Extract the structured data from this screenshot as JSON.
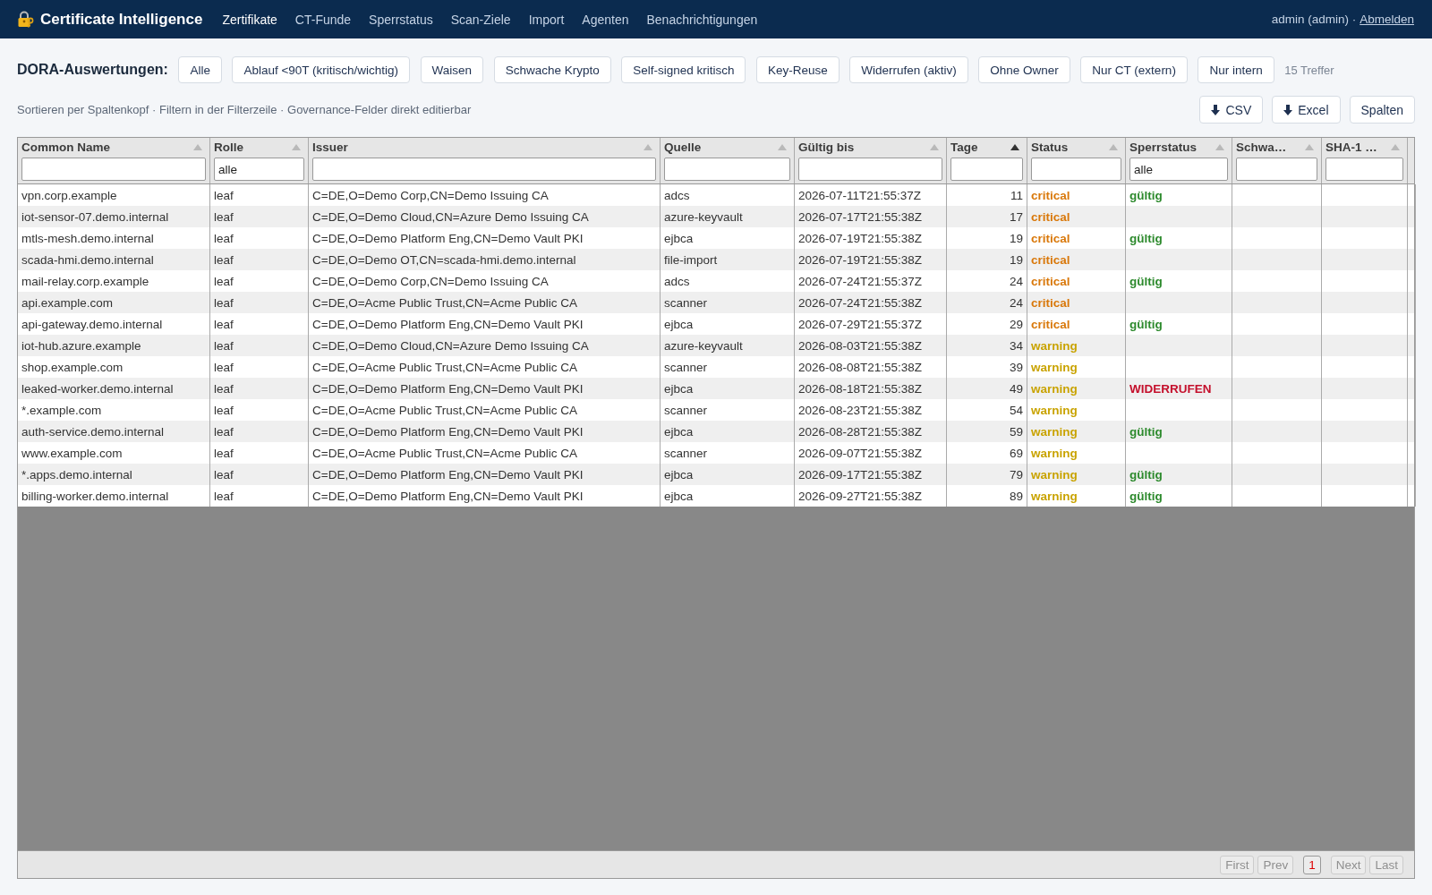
{
  "navbar": {
    "brand": "Certificate Intelligence",
    "nav_items": [
      {
        "label": "Zertifikate",
        "selected": true
      },
      {
        "label": "CT-Funde",
        "selected": false
      },
      {
        "label": "Sperrstatus",
        "selected": false
      },
      {
        "label": "Scan-Ziele",
        "selected": false
      },
      {
        "label": "Import",
        "selected": false
      },
      {
        "label": "Agenten",
        "selected": false
      },
      {
        "label": "Benachrichtigungen",
        "selected": false
      }
    ],
    "user": "admin (admin) ·",
    "logout": "Abmelden"
  },
  "dora_filters": {
    "label": "DORA-Auswertungen:",
    "buttons": [
      "Alle",
      "Ablauf <90T (kritisch/wichtig)",
      "Waisen",
      "Schwache Krypto",
      "Self-signed kritisch",
      "Key-Reuse",
      "Widerrufen (aktiv)",
      "Ohne Owner",
      "Nur CT (extern)",
      "Nur intern"
    ],
    "result_count": "15 Treffer"
  },
  "hint": "Sortieren per Spaltenkopf · Filtern in der Filterzeile · Governance-Felder direkt editierbar",
  "actions": [
    {
      "label": "CSV",
      "kind": "download"
    },
    {
      "label": "Excel",
      "kind": "download"
    },
    {
      "label": "Spalten",
      "kind": "plain"
    }
  ],
  "table": {
    "columns": [
      {
        "title": "Common Name",
        "kind": "text",
        "sorted": false
      },
      {
        "title": "Rolle",
        "kind": "text",
        "sorted": false,
        "filter": "alle"
      },
      {
        "title": "Issuer",
        "kind": "text",
        "sorted": false
      },
      {
        "title": "Quelle",
        "kind": "text",
        "sorted": false
      },
      {
        "title": "Gültig bis",
        "kind": "text",
        "sorted": false
      },
      {
        "title": "Tage",
        "kind": "number",
        "sorted": true
      },
      {
        "title": "Status",
        "kind": "text",
        "sorted": false
      },
      {
        "title": "Sperrstatus",
        "kind": "text",
        "sorted": false,
        "filter": "alle"
      },
      {
        "title": "Schwa…",
        "kind": "text",
        "sorted": false
      },
      {
        "title": "SHA-1 …",
        "kind": "text",
        "sorted": false
      }
    ],
    "rows": [
      {
        "common_name": "vpn.corp.example",
        "role": "leaf",
        "issuer": "C=DE,O=Demo Corp,CN=Demo Issuing CA",
        "source": "adcs",
        "valid_until": "2026-07-11T21:55:37Z",
        "days": "11",
        "status": {
          "text": "critical",
          "color": "#d9780a"
        },
        "revocation": {
          "text": "gültig",
          "color": "#2d8a2d"
        }
      },
      {
        "common_name": "iot-sensor-07.demo.internal",
        "role": "leaf",
        "issuer": "C=DE,O=Demo Cloud,CN=Azure Demo Issuing CA",
        "source": "azure-keyvault",
        "valid_until": "2026-07-17T21:55:38Z",
        "days": "17",
        "status": {
          "text": "critical",
          "color": "#d9780a"
        }
      },
      {
        "common_name": "mtls-mesh.demo.internal",
        "role": "leaf",
        "issuer": "C=DE,O=Demo Platform Eng,CN=Demo Vault PKI",
        "source": "ejbca",
        "valid_until": "2026-07-19T21:55:38Z",
        "days": "19",
        "status": {
          "text": "critical",
          "color": "#d9780a"
        },
        "revocation": {
          "text": "gültig",
          "color": "#2d8a2d"
        }
      },
      {
        "common_name": "scada-hmi.demo.internal",
        "role": "leaf",
        "issuer": "C=DE,O=Demo OT,CN=scada-hmi.demo.internal",
        "source": "file-import",
        "valid_until": "2026-07-19T21:55:38Z",
        "days": "19",
        "status": {
          "text": "critical",
          "color": "#d9780a"
        }
      },
      {
        "common_name": "mail-relay.corp.example",
        "role": "leaf",
        "issuer": "C=DE,O=Demo Corp,CN=Demo Issuing CA",
        "source": "adcs",
        "valid_until": "2026-07-24T21:55:37Z",
        "days": "24",
        "status": {
          "text": "critical",
          "color": "#d9780a"
        },
        "revocation": {
          "text": "gültig",
          "color": "#2d8a2d"
        }
      },
      {
        "common_name": "api.example.com",
        "role": "leaf",
        "issuer": "C=DE,O=Acme Public Trust,CN=Acme Public CA",
        "source": "scanner",
        "valid_until": "2026-07-24T21:55:38Z",
        "days": "24",
        "status": {
          "text": "critical",
          "color": "#d9780a"
        }
      },
      {
        "common_name": "api-gateway.demo.internal",
        "role": "leaf",
        "issuer": "C=DE,O=Demo Platform Eng,CN=Demo Vault PKI",
        "source": "ejbca",
        "valid_until": "2026-07-29T21:55:37Z",
        "days": "29",
        "status": {
          "text": "critical",
          "color": "#d9780a"
        },
        "revocation": {
          "text": "gültig",
          "color": "#2d8a2d"
        }
      },
      {
        "common_name": "iot-hub.azure.example",
        "role": "leaf",
        "issuer": "C=DE,O=Demo Cloud,CN=Azure Demo Issuing CA",
        "source": "azure-keyvault",
        "valid_until": "2026-08-03T21:55:38Z",
        "days": "34",
        "status": {
          "text": "warning",
          "color": "#c9a300"
        }
      },
      {
        "common_name": "shop.example.com",
        "role": "leaf",
        "issuer": "C=DE,O=Acme Public Trust,CN=Acme Public CA",
        "source": "scanner",
        "valid_until": "2026-08-08T21:55:38Z",
        "days": "39",
        "status": {
          "text": "warning",
          "color": "#c9a300"
        }
      },
      {
        "common_name": "leaked-worker.demo.internal",
        "role": "leaf",
        "issuer": "C=DE,O=Demo Platform Eng,CN=Demo Vault PKI",
        "source": "ejbca",
        "valid_until": "2026-08-18T21:55:38Z",
        "days": "49",
        "status": {
          "text": "warning",
          "color": "#c9a300"
        },
        "revocation": {
          "text": "WIDERRUFEN",
          "color": "#c4102c"
        }
      },
      {
        "common_name": "*.example.com",
        "role": "leaf",
        "issuer": "C=DE,O=Acme Public Trust,CN=Acme Public CA",
        "source": "scanner",
        "valid_until": "2026-08-23T21:55:38Z",
        "days": "54",
        "status": {
          "text": "warning",
          "color": "#c9a300"
        }
      },
      {
        "common_name": "auth-service.demo.internal",
        "role": "leaf",
        "issuer": "C=DE,O=Demo Platform Eng,CN=Demo Vault PKI",
        "source": "ejbca",
        "valid_until": "2026-08-28T21:55:38Z",
        "days": "59",
        "status": {
          "text": "warning",
          "color": "#c9a300"
        },
        "revocation": {
          "text": "gültig",
          "color": "#2d8a2d"
        }
      },
      {
        "common_name": "www.example.com",
        "role": "leaf",
        "issuer": "C=DE,O=Acme Public Trust,CN=Acme Public CA",
        "source": "scanner",
        "valid_until": "2026-09-07T21:55:38Z",
        "days": "69",
        "status": {
          "text": "warning",
          "color": "#c9a300"
        }
      },
      {
        "common_name": "*.apps.demo.internal",
        "role": "leaf",
        "issuer": "C=DE,O=Demo Platform Eng,CN=Demo Vault PKI",
        "source": "ejbca",
        "valid_until": "2026-09-17T21:55:38Z",
        "days": "79",
        "status": {
          "text": "warning",
          "color": "#c9a300"
        },
        "revocation": {
          "text": "gültig",
          "color": "#2d8a2d"
        }
      },
      {
        "common_name": "billing-worker.demo.internal",
        "role": "leaf",
        "issuer": "C=DE,O=Demo Platform Eng,CN=Demo Vault PKI",
        "source": "ejbca",
        "valid_until": "2026-09-27T21:55:38Z",
        "days": "89",
        "status": {
          "text": "warning",
          "color": "#c9a300"
        },
        "revocation": {
          "text": "gültig",
          "color": "#2d8a2d"
        }
      }
    ],
    "pagination": [
      {
        "label": "First",
        "kind": "nav",
        "disabled": true
      },
      {
        "label": "Prev",
        "kind": "nav",
        "disabled": true
      },
      {
        "label": "1",
        "kind": "page",
        "selected": true
      },
      {
        "label": "Next",
        "kind": "nav",
        "disabled": true
      },
      {
        "label": "Last",
        "kind": "nav",
        "disabled": true
      }
    ]
  }
}
